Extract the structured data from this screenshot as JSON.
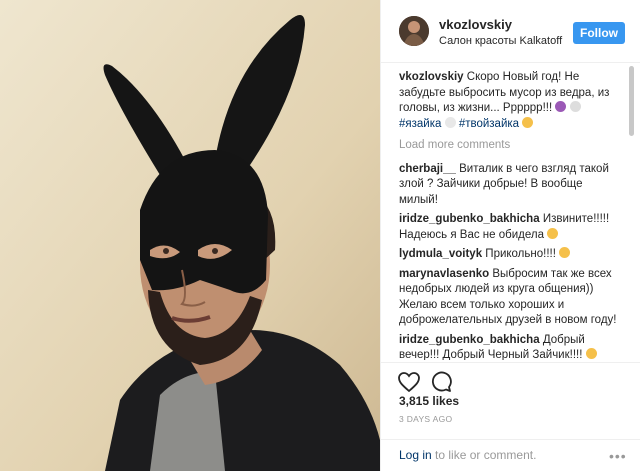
{
  "header": {
    "username": "vkozlovskiy",
    "location": "Салон красоты Kalkatoff",
    "follow_label": "Follow"
  },
  "caption": {
    "username": "vkozlovskiy",
    "text": "Скоро Новый год! Не забудьте выбросить мусор из ведра, из головы, из жизни... Рррррр!!!",
    "hashtag1": "#язайка",
    "hashtag2": "#твойзайка"
  },
  "load_more": "Load more comments",
  "comments": [
    {
      "user": "cherbaji__",
      "text": "Виталик в чего взгляд такой злой ? Зайчики добрые! В вообще милый!"
    },
    {
      "user": "iridze_gubenko_bakhicha",
      "text": "Извините!!!!! Надеюсь я Вас не обидела"
    },
    {
      "user": "lydmula_voityk",
      "text": "Прикольно!!!!"
    },
    {
      "user": "marynavlasenko",
      "text": "Выбросим так же всех недобрых людей из круга общения)) Желаю всем только хороших и доброжелательных друзей в новом году!"
    },
    {
      "user": "iridze_gubenko_bakhicha",
      "text": "Добрый вечер!!! Добрый Черный Зайчик!!!!"
    }
  ],
  "likes": "3,815 likes",
  "time": "3 DAYS AGO",
  "login": {
    "link": "Log in",
    "rest": " to like or comment."
  },
  "more_dots": "•••",
  "icons": {
    "like": "heart-icon",
    "comment": "comment-bubble-icon"
  },
  "colors": {
    "accent": "#3897f0",
    "link": "#003569",
    "muted": "#999999"
  }
}
